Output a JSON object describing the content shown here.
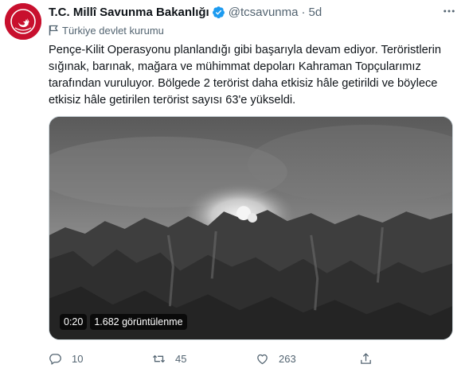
{
  "tweet": {
    "display_name": "T.C. Millî Savunma Bakanlığı",
    "handle": "@tcsavunma",
    "separator": "·",
    "time": "5d",
    "account_label": "Türkiye devlet kurumu",
    "text": "Pençe-Kilit Operasyonu planlandığı gibi başarıyla devam ediyor. Teröristlerin sığınak, barınak, mağara ve mühimmat depoları Kahraman Topçularımız tarafından vuruluyor. Bölgede 2 terörist daha etkisiz hâle getirildi ve böylece etkisiz hâle getirilen terörist sayısı 63'e yükseldi.",
    "video": {
      "duration": "0:20",
      "views": "1.682 görüntülenme"
    },
    "stats": {
      "replies": "10",
      "retweets": "45",
      "likes": "263"
    }
  },
  "icons": {
    "verified": "verified-badge-icon",
    "more": "more-icon",
    "flag": "flag-icon",
    "reply": "reply-icon",
    "retweet": "retweet-icon",
    "like": "like-icon",
    "share": "share-icon"
  },
  "colors": {
    "avatar_bg": "#c8102e",
    "verified": "#1d9bf0",
    "secondary_text": "#536471",
    "primary_text": "#0f1419"
  }
}
